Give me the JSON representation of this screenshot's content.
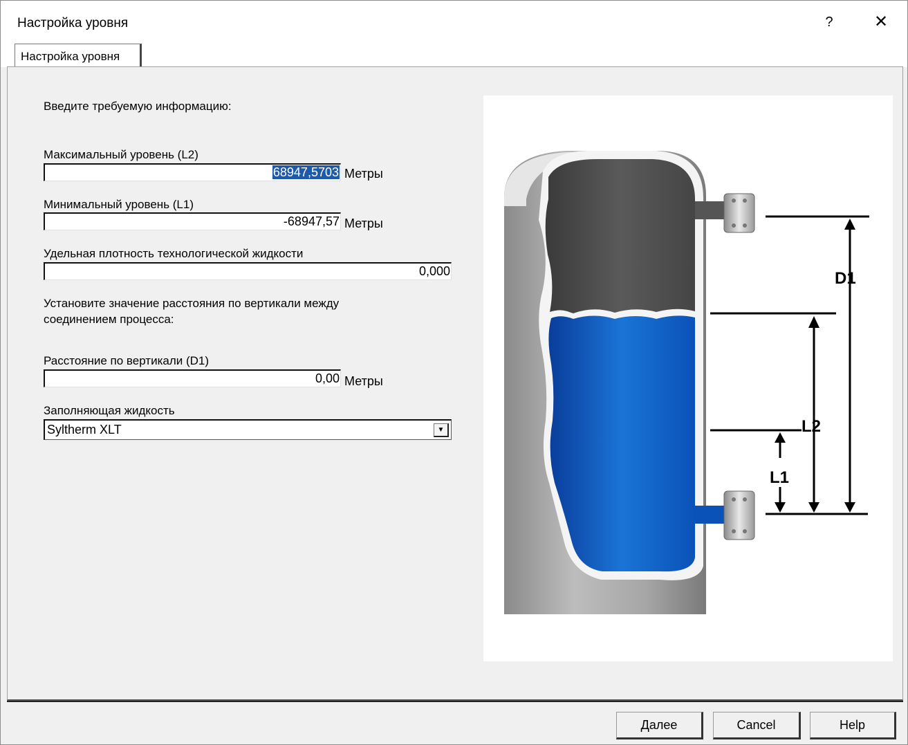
{
  "window": {
    "title": "Настройка уровня",
    "help_glyph": "?",
    "close_glyph": "✕"
  },
  "tabs": [
    {
      "label": "Настройка уровня",
      "active": true
    }
  ],
  "form": {
    "intro": "Введите требуемую информацию:",
    "max_level": {
      "label": "Максимальный уровень (L2)",
      "value": "68947,5703",
      "unit": "Метры"
    },
    "min_level": {
      "label": "Минимальный уровень (L1)",
      "value": "-68947,57",
      "unit": "Метры"
    },
    "density": {
      "label": "Удельная плотность технологической жидкости",
      "value": "0,000"
    },
    "instruction_line1": "Установите значение расстояния по вертикали между",
    "instruction_line2": "соединением процесса:",
    "distance": {
      "label": "Расстояние по вертикали (D1)",
      "value": "0,00",
      "unit": "Метры"
    },
    "fill_fluid": {
      "label": "Заполняющая жидкость",
      "value": "Syltherm XLT"
    }
  },
  "diagram": {
    "labels": {
      "d1": "D1",
      "l2": "L2",
      "l1": "L1"
    }
  },
  "buttons": {
    "next": "Далее",
    "cancel": "Cancel",
    "help": "Help"
  },
  "colors": {
    "selection": "#1e5aa8",
    "liquid": "#0a5fd0",
    "vapor": "#4d4d4d"
  }
}
